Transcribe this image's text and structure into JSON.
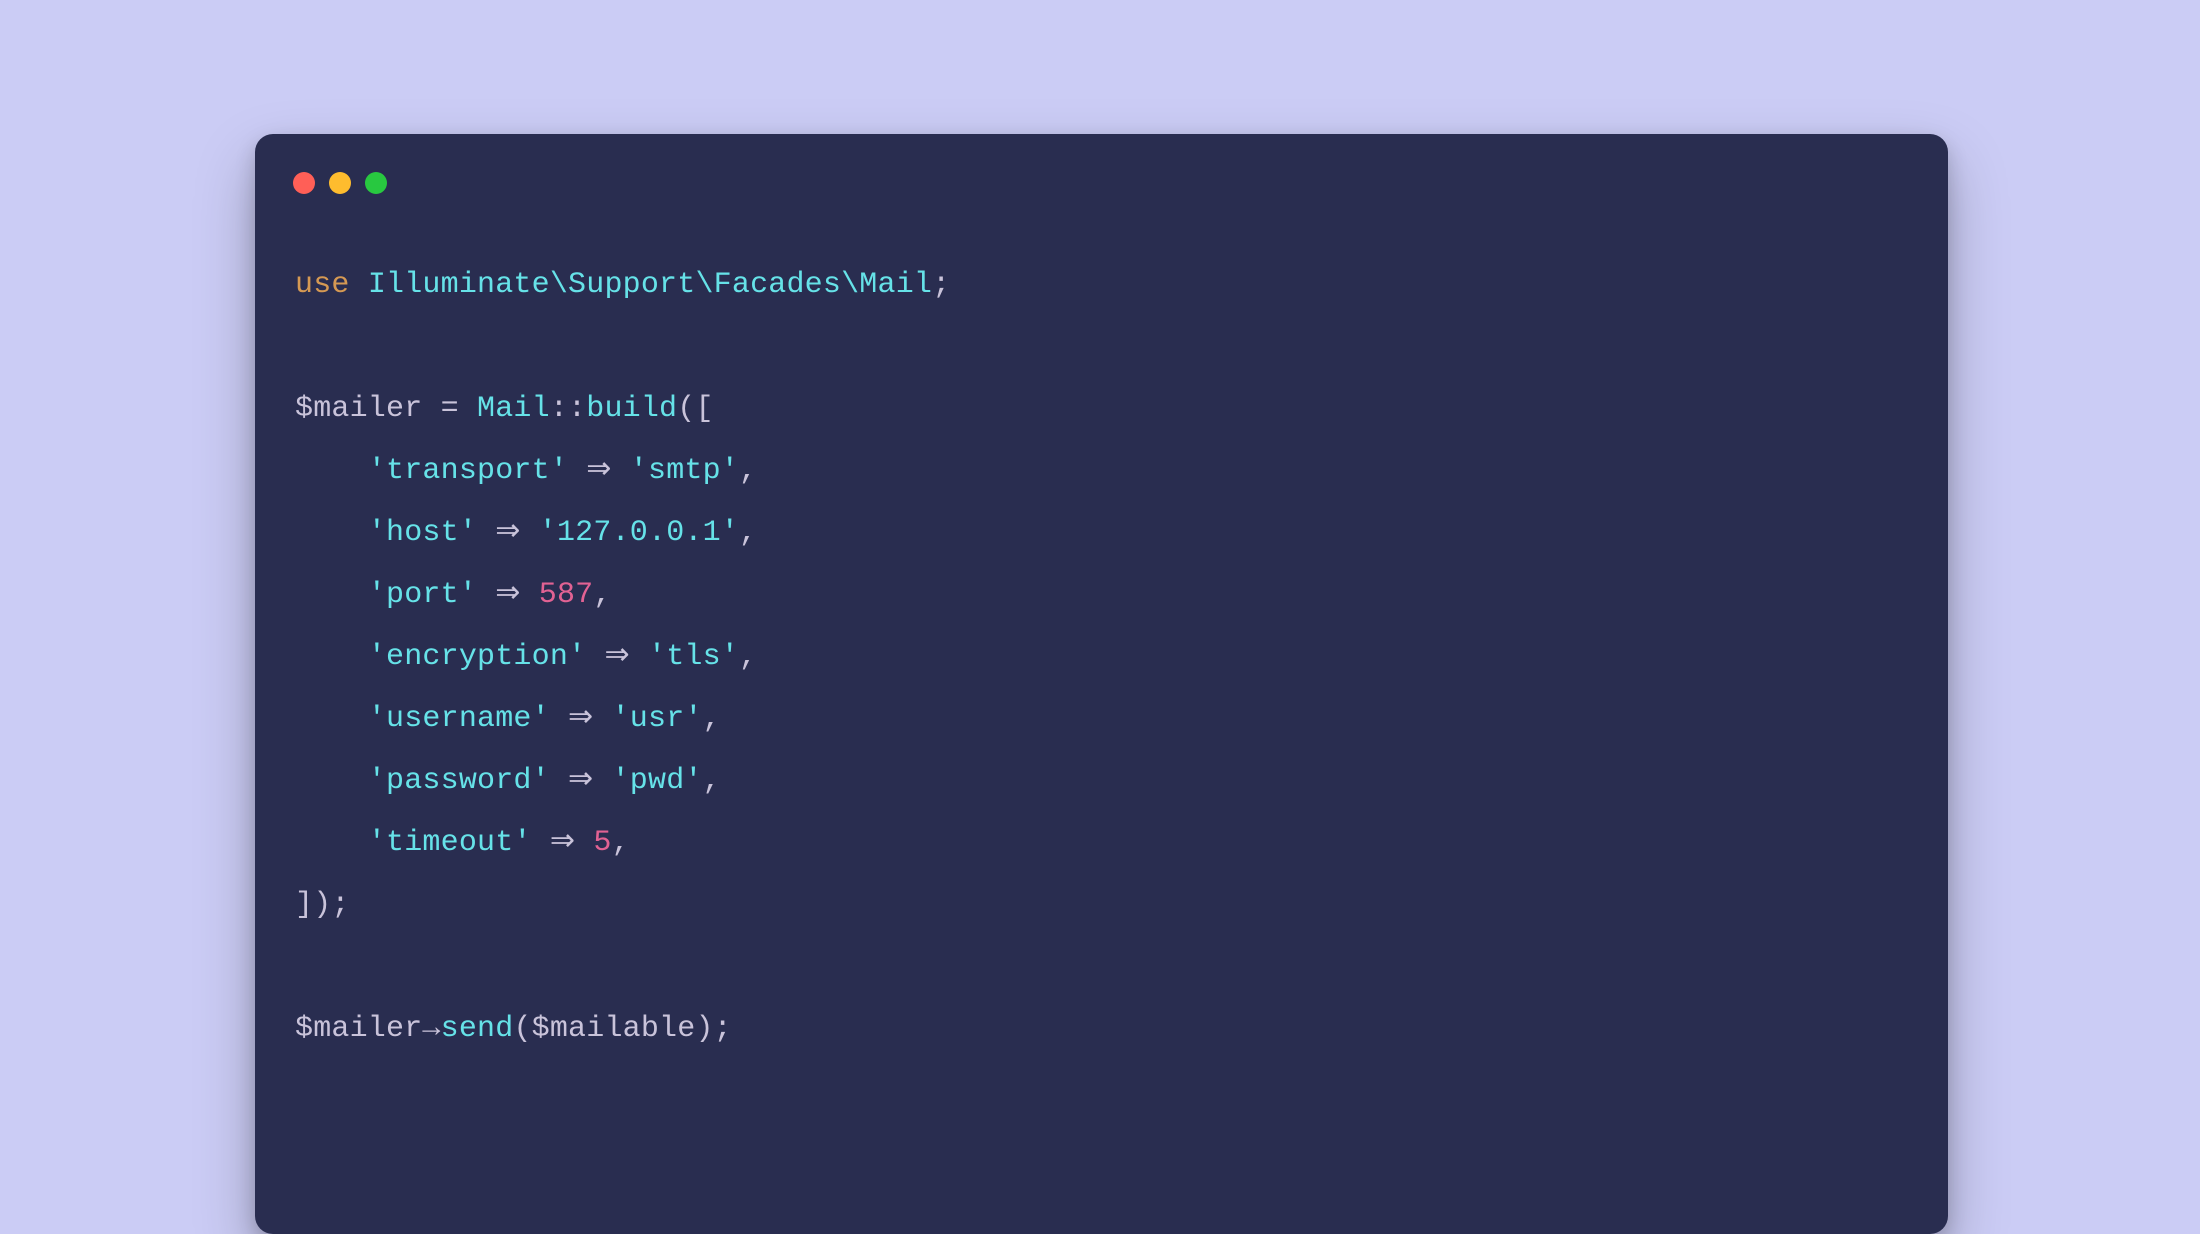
{
  "traffic_lights": {
    "red": "#ff5f57",
    "yellow": "#febc2e",
    "green": "#28c840"
  },
  "code": {
    "use_kw": "use",
    "namespace": "Illuminate\\Support\\Facades\\Mail",
    "mailer_var": "$mailer",
    "equals": " = ",
    "mail_class": "Mail",
    "dbl_colon": "::",
    "build_fn": "build",
    "open": "([",
    "arr": {
      "k_transport": "'transport'",
      "v_transport": "'smtp'",
      "k_host": "'host'",
      "v_host": "'127.0.0.1'",
      "k_port": "'port'",
      "v_port": "587",
      "k_encryption": "'encryption'",
      "v_encryption": "'tls'",
      "k_username": "'username'",
      "v_username": "'usr'",
      "k_password": "'password'",
      "v_password": "'pwd'",
      "k_timeout": "'timeout'",
      "v_timeout": "5"
    },
    "fat_arrow": " ⇒ ",
    "thin_arrow": "→",
    "comma": ",",
    "close": "]);",
    "semicolon": ";",
    "mailable_var": "$mailable",
    "send_fn": "send",
    "open_paren": "(",
    "close_paren": ")"
  }
}
